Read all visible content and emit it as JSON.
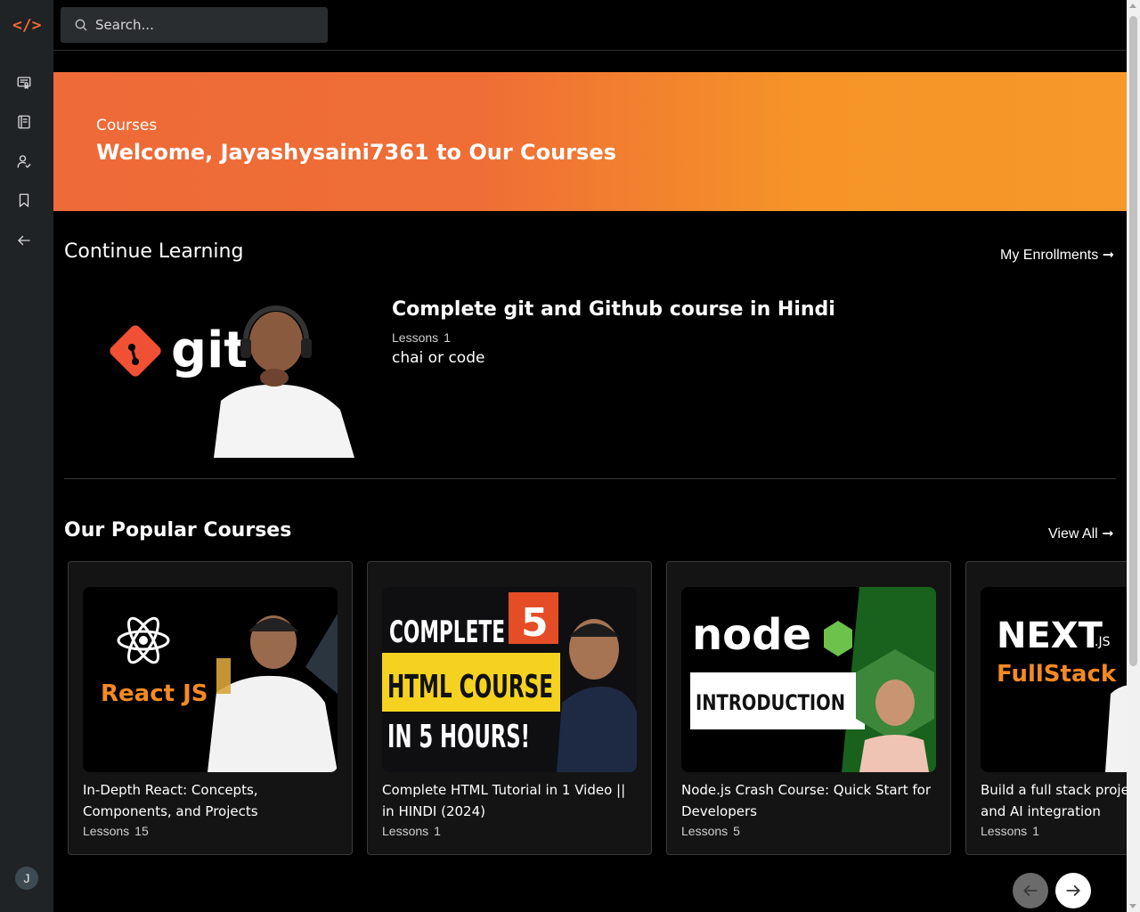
{
  "sidebar": {
    "logo_text": "</>",
    "items": [
      {
        "icon": "certificate-icon"
      },
      {
        "icon": "book-icon"
      },
      {
        "icon": "user-check-icon"
      },
      {
        "icon": "bookmark-icon"
      },
      {
        "icon": "arrow-left-icon"
      }
    ],
    "avatar_initial": "J"
  },
  "search": {
    "placeholder": "Search..."
  },
  "banner": {
    "subtitle": "Courses",
    "title": "Welcome, Jayashysaini7361 to Our Courses"
  },
  "continue_learning": {
    "heading": "Continue Learning",
    "link": "My Enrollments",
    "course": {
      "thumb_text": "git",
      "title": "Complete git and Github course in Hindi",
      "lessons_label": "Lessons",
      "lessons_count": "1",
      "author": "chai or code"
    }
  },
  "popular": {
    "heading": "Our Popular Courses",
    "link": "View All",
    "courses": [
      {
        "title": "In-Depth React: Concepts, Components, and Projects",
        "lessons_label": "Lessons",
        "lessons_count": "15",
        "thumb": {
          "line1": "React JS"
        }
      },
      {
        "title": "Complete HTML Tutorial in 1 Video || in HINDI (2024)",
        "lessons_label": "Lessons",
        "lessons_count": "1",
        "thumb": {
          "line1": "COMPLETE",
          "line2": "HTML COURSE",
          "line3": "IN 5 HOURS!",
          "badge": "5"
        }
      },
      {
        "title": "Node.js Crash Course: Quick Start for Developers",
        "lessons_label": "Lessons",
        "lessons_count": "5",
        "thumb": {
          "line1": "node",
          "line2": "INTRODUCTION"
        }
      },
      {
        "title": "Build a full stack project with NextJS and AI integration",
        "lessons_label": "Lessons",
        "lessons_count": "1",
        "thumb": {
          "line1": "NEXT",
          "line1b": ".JS",
          "line2": "FullStack"
        }
      }
    ]
  },
  "colors": {
    "accent": "#f26a2e",
    "banner_start": "#ee6a38",
    "banner_end": "#f6982a",
    "sidebar_bg": "#1f2326"
  }
}
